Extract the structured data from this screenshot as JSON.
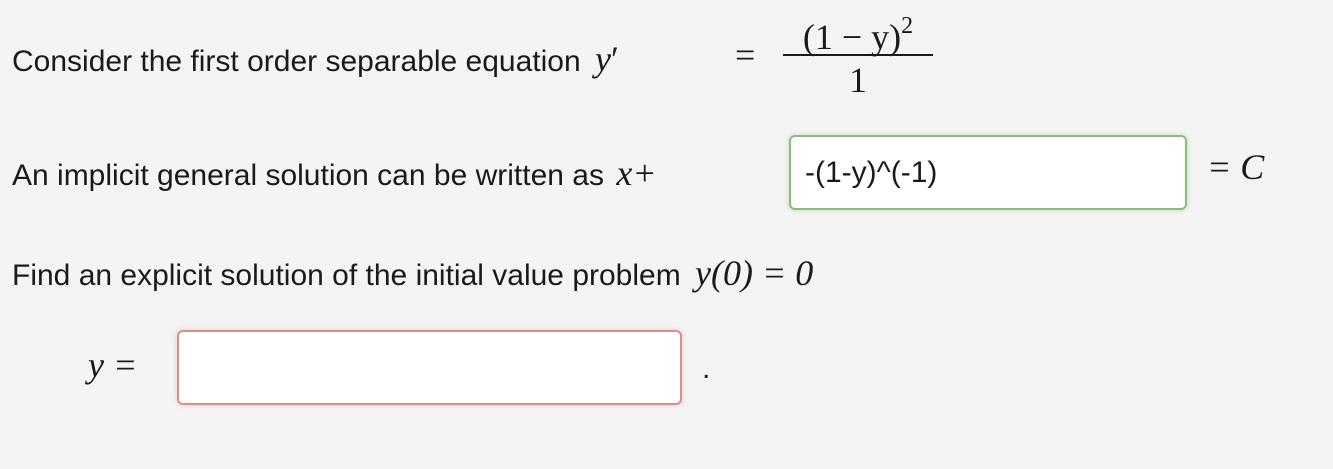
{
  "line1": {
    "text": "Consider the first order separable equation",
    "lhs": "y",
    "prime": "′",
    "eq": "=",
    "numerator": "(1 − y)",
    "exponent": "2",
    "denominator": "1"
  },
  "line2": {
    "text": "An implicit general solution can be written as",
    "x_plus": "x+",
    "input_value": "-(1-y)^(-1)",
    "rhs": "= C"
  },
  "line3": {
    "text": "Find an explicit solution of the initial value problem",
    "condition": "y(0) = 0"
  },
  "line4": {
    "lhs": "y =",
    "input_value": "",
    "period": "."
  }
}
